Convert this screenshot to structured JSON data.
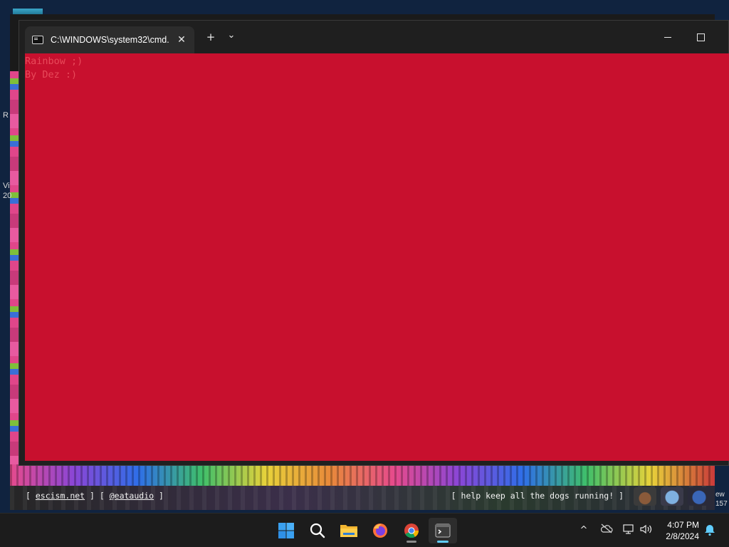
{
  "window": {
    "tab_title": "C:\\WINDOWS\\system32\\cmd.",
    "tab_close_glyph": "✕",
    "new_tab_glyph": "+",
    "dropdown_glyph": "⌄"
  },
  "console": {
    "background": "#c8102e",
    "text_color": "#e84a5a",
    "lines": [
      "Rainbow ;)",
      "By Dez :)"
    ]
  },
  "background_app": {
    "left_links": [
      "escism.net",
      "@eataudio"
    ],
    "right_text": "[ help keep all the dogs running! ]",
    "edge_text": [
      "ew",
      "157"
    ]
  },
  "desktop": {
    "left_text": [
      "R",
      "Vi",
      "20"
    ]
  },
  "taskbar": {
    "apps": [
      {
        "name": "start",
        "icon": "windows-start-icon"
      },
      {
        "name": "search",
        "icon": "search-icon"
      },
      {
        "name": "file-explorer",
        "icon": "folder-icon"
      },
      {
        "name": "firefox",
        "icon": "firefox-icon"
      },
      {
        "name": "chrome",
        "icon": "chrome-icon"
      },
      {
        "name": "terminal",
        "icon": "terminal-icon",
        "active": true
      }
    ],
    "tray": {
      "chevron_glyph": "^",
      "time": "4:07 PM",
      "date": "2/8/2024"
    }
  }
}
